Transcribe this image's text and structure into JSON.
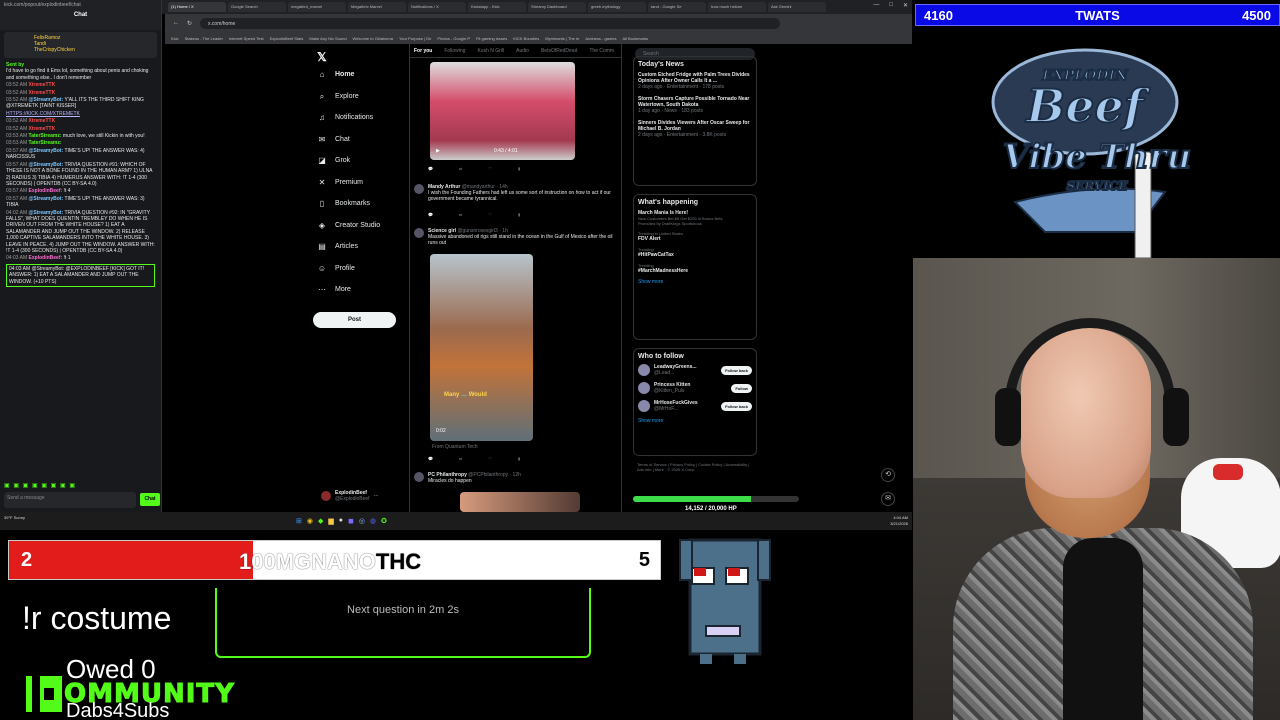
{
  "browser": {
    "url": "x.com/home",
    "tabs": [
      "(1) Home / X",
      "Google Search",
      "megathrd_marvel",
      "Megathric Marvel",
      "Notifications / X",
      "Kickstapp - Kick",
      "Streamy Dashboard",
      "greek mythology",
      "tarot - Google Se",
      "how much helium",
      "Ask Gemini"
    ],
    "bookmarks": [
      "Kick",
      "Stakeus - The Leader",
      "Internet Speed Test",
      "ExplodinBeef Stats",
      "Make Any Nix Sound",
      "Welcome to Oklahoma",
      "Your Purpose | Dir",
      "Photos - Google P",
      "Fit gaming issues",
      "KICK Bounties",
      "Mymmants | The Ie",
      "Andness - games",
      "All Bookmarks"
    ]
  },
  "kick_chat": {
    "url_bar": "kick.com/popout/explodinbeef/chat",
    "title": "Chat",
    "pinned_lines": [
      "FelixRamoz",
      "Tandi",
      "TheCrispyChicken"
    ],
    "sent_by": "Sent by",
    "top_message": "I'd have to go find it Ems lol, something about penis and choking and something else.. I don't remember",
    "messages": [
      {
        "time": "03:52 AM",
        "user": "XtremeTTK",
        "color": "red",
        "text": ""
      },
      {
        "time": "03:52 AM",
        "user": "XtremeTTK",
        "color": "red",
        "text": ""
      },
      {
        "time": "03:52 AM",
        "user": "@StreamyBot:",
        "color": "blue",
        "text": "Y'ALL ITS THE THIRD SHIFT KING @XTREMETK [TAINT KISSER]"
      },
      {
        "time": "",
        "user": "",
        "color": "",
        "text": "HTTPS://KICK.COM/XTREMETK",
        "link": true
      },
      {
        "time": "03:52 AM",
        "user": "XtremeTTK",
        "color": "red",
        "text": ""
      },
      {
        "time": "03:52 AM",
        "user": "XtremeTTK",
        "color": "red",
        "text": ""
      },
      {
        "time": "03:53 AM",
        "user": "TaterStreamz:",
        "color": "green",
        "text": "much love, we still Kickin in with you!"
      },
      {
        "time": "03:53 AM",
        "user": "TaterStreamz:",
        "color": "green",
        "text": ""
      },
      {
        "time": "03:57 AM",
        "user": "@StreamyBot:",
        "color": "blue",
        "text": "TIME'S UP! THE ANSWER WAS: 4) NARCISSUS"
      },
      {
        "time": "03:57 AM",
        "user": "@StreamyBot:",
        "color": "blue",
        "text": "TRIVIA QUESTION #91: WHICH OF THESE IS NOT A BONE FOUND IN THE HUMAN ARM? 1) ULNA 2) RADIUS 3) TIBIA 4) HUMERUS ANSWER WITH: !T 1-4 (300 SECONDS) | OPENTDB (CC BY-SA 4.0)"
      },
      {
        "time": "03:57 AM",
        "user": "ExplodinBeef:",
        "color": "pink",
        "text": "!t 4"
      },
      {
        "time": "03:57 AM",
        "user": "@StreamyBot:",
        "color": "blue",
        "text": "TIME'S UP! THE ANSWER WAS: 3) TIBIA"
      },
      {
        "time": "04:02 AM",
        "user": "@StreamyBot:",
        "color": "blue",
        "text": "TRIVIA QUESTION #92: IN \"GRAVITY FALLS\", WHAT DOES QUENTIN TREMBLEY DO WHEN HE IS DRIVEN OUT FROM THE WHITE HOUSE? 1) EAT A SALAMANDER AND JUMP OUT THE WINDOW. 2) RELEASE 1,000 CAPTIVE SALAMANDERS INTO THE WHITE HOUSE. 3) LEAVE IN PEACE. 4) JUMP OUT THE WINDOW. ANSWER WITH: !T 1-4 (300 SECONDS) | OPENTDB (CC BY-SA 4.0)"
      },
      {
        "time": "04:03 AM",
        "user": "ExplodinBeef:",
        "color": "pink",
        "text": "!t 1"
      }
    ],
    "system_message": "04:03 AM @StreamyBot: @EXPLODINBEEF [KICK] GOT IT! ANSWER: 1) EAT A SALAMANDER AND JUMP OUT THE WINDOW. (+10 PTS)",
    "input_placeholder": "Send a message",
    "chat_button": "Chat"
  },
  "x": {
    "nav": [
      {
        "label": "Home",
        "icon": "home-icon"
      },
      {
        "label": "Explore",
        "icon": "search-icon"
      },
      {
        "label": "Notifications",
        "icon": "bell-icon"
      },
      {
        "label": "Chat",
        "icon": "mail-icon"
      },
      {
        "label": "Grok",
        "icon": "grok-icon"
      },
      {
        "label": "Premium",
        "icon": "x-premium-icon"
      },
      {
        "label": "Bookmarks",
        "icon": "bookmark-icon"
      },
      {
        "label": "Creator Studio",
        "icon": "studio-icon"
      },
      {
        "label": "Articles",
        "icon": "article-icon"
      },
      {
        "label": "Profile",
        "icon": "person-icon"
      },
      {
        "label": "More",
        "icon": "more-icon"
      }
    ],
    "post_button": "Post",
    "account_name": "ExplodinBeef",
    "account_handle": "@ExplodinBeef",
    "feed_tabs": [
      "For you",
      "Following",
      "Kush N Grill",
      "Audio",
      "BetsOfRedDead",
      "The Comm"
    ],
    "video1_time": "0:43 / 4:01",
    "tweets": [
      {
        "name": "Mandy Arthur",
        "handle": "@mandyarthur · 14h",
        "text": "I wish the Founding Fathers had left us some sort of instruction on how to act if our government became tyrannical."
      },
      {
        "name": "Science girl",
        "handle": "@gunsnrosesgirl3 · 1h",
        "text": "Massive abandoned oil rigs still stand in the ocean in the Gulf of Mexico after the oil runs out"
      },
      {
        "name": "PC Philanthropy",
        "handle": "@PCPhilanthropy · 12h",
        "text": "Miracles do happen"
      }
    ],
    "video2_caption": "Many",
    "video2_caption2": "Would",
    "video2_time": "0:02",
    "video2_source": "From Quantum Tech",
    "search_placeholder": "Search",
    "todays_news_title": "Today's News",
    "news": [
      {
        "title": "Custom Etched Fridge with Palm Trees Divides Opinions After Owner Calls It a ...",
        "meta": "2 days ago · Entertainment · 178 posts"
      },
      {
        "title": "Storm Chasers Capture Possible Tornado Near Watertown, South Dakota",
        "meta": "1 day ago · News · 183 posts"
      },
      {
        "title": "Sinners Divides Viewers After Oscar Sweep for Michael B. Jordan",
        "meta": "2 days ago · Entertainment · 3.8K posts"
      }
    ],
    "happening_title": "What's happening",
    "trends": [
      {
        "category": "",
        "title": "March Mania Is Here!",
        "sub": "New Customers Bet $5 Get $200 in Bonus Bets",
        "promo": "Promoted by DraftKings Sportsbook"
      },
      {
        "category": "Trending in United States",
        "title": "FDV Alert",
        "sub": "",
        "promo": ""
      },
      {
        "category": "Trending",
        "title": "#HitPawCatTax",
        "sub": "",
        "promo": ""
      },
      {
        "category": "Trending",
        "title": "#MarchMadnessHere",
        "sub": "",
        "promo": ""
      }
    ],
    "show_more": "Show more",
    "who_to_follow_title": "Who to follow",
    "follow": [
      {
        "name": "LeadwayGreens...",
        "handle": "@Lead...",
        "button": "Follow back"
      },
      {
        "name": "Princess Kitten",
        "handle": "@Kitten_Puls",
        "button": "Follow"
      },
      {
        "name": "MrHoseFuckGives",
        "handle": "@MrHoF...",
        "button": "Follow back"
      }
    ],
    "footer": "Terms of Service | Privacy Policy | Cookie Policy | Accessibility | Ads info | More · © 2026 X Corp."
  },
  "hp": {
    "text": "14,152 / 20,000 HP",
    "fraction": 0.71
  },
  "taskbar": {
    "weather": "39°F Sunny",
    "time": "4:04 AM",
    "date": "3/21/2026"
  },
  "overlay": {
    "score_left": "4160",
    "score_label": "TWATS",
    "score_right": "4500",
    "logo_line1": "EXPLODIN",
    "logo_line2": "Beef",
    "logo_line3": "Vibe Thru",
    "logo_line4": "SERVICE",
    "vote_left": "2",
    "vote_name_a": "100MGNANO",
    "vote_name_b": "THC",
    "vote_right": "5",
    "vote_fraction": 0.375,
    "command": "!r costume",
    "question": "Next question in 2m 2s",
    "owed": "Owed 0",
    "community": "OMMUNITY",
    "dabs": "Dabs4Subs"
  },
  "colors": {
    "kick_green": "#53fc18",
    "vote_red": "#e21b1b",
    "score_blue": "#0a0ae6",
    "x_blue": "#1d9bf0"
  }
}
